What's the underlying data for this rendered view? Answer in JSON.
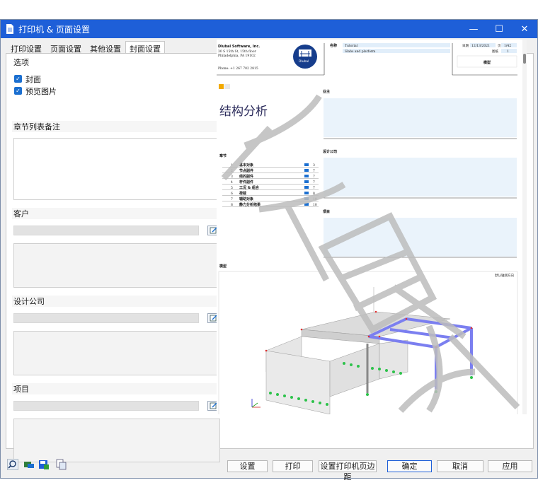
{
  "window": {
    "title": "打印机 & 页面设置",
    "controls": [
      "—",
      "☐",
      "✕"
    ]
  },
  "tabs": [
    {
      "label": "打印设置"
    },
    {
      "label": "页面设置"
    },
    {
      "label": "其他设置"
    },
    {
      "label": "封面设置",
      "active": true
    }
  ],
  "options": {
    "heading": "选项",
    "cover": "封面",
    "preview_image": "预览图片"
  },
  "chapter_notes": {
    "heading": "章节列表备注"
  },
  "client": {
    "heading": "客户"
  },
  "design_company": {
    "heading": "设计公司"
  },
  "project": {
    "heading": "项目"
  },
  "preview": {
    "company_name": "Dlubal Software, Inc.",
    "address1": "30 S 15th St, 15th floor",
    "address2": "Philadelphia, PA 19102",
    "phone": "Phone: +1 267 702 2815",
    "logo_text": "Dlubal",
    "name_label": "名称",
    "name_value": "Tutorial",
    "model_value": "Slabs and platform",
    "date_label": "日期",
    "date_value": "12/13/2021",
    "page_label": "页",
    "page_value": "1/42",
    "sheet_label": "图纸",
    "sheet_value": "1",
    "model_label": "模型",
    "owner_label": "业主",
    "main_title": "结构分析",
    "chapter_label": "章节",
    "design_company_label": "设计公司",
    "project_label": "项目",
    "chapters": [
      {
        "no": "1",
        "name": "基本对象",
        "page": "3"
      },
      {
        "no": "2",
        "name": "节点副件",
        "page": "7"
      },
      {
        "no": "3",
        "name": "线的副件",
        "page": "7"
      },
      {
        "no": "4",
        "name": "杆件副件",
        "page": "7"
      },
      {
        "no": "5",
        "name": "工况 & 组合",
        "page": "7"
      },
      {
        "no": "6",
        "name": "荷载",
        "page": "8"
      },
      {
        "no": "7",
        "name": "辅助对象",
        "page": "10"
      },
      {
        "no": "8",
        "name": "静力分析结果",
        "page": "10"
      }
    ],
    "view_label": "默认轴测方向"
  },
  "buttons": {
    "settings": "设置",
    "print": "打印",
    "printer_margins": "设置打印机页边距",
    "ok": "确定",
    "cancel": "取消",
    "apply": "应用"
  },
  "colors": {
    "titlebar": "#1e5fd8",
    "accent": "#1b6fd0"
  }
}
